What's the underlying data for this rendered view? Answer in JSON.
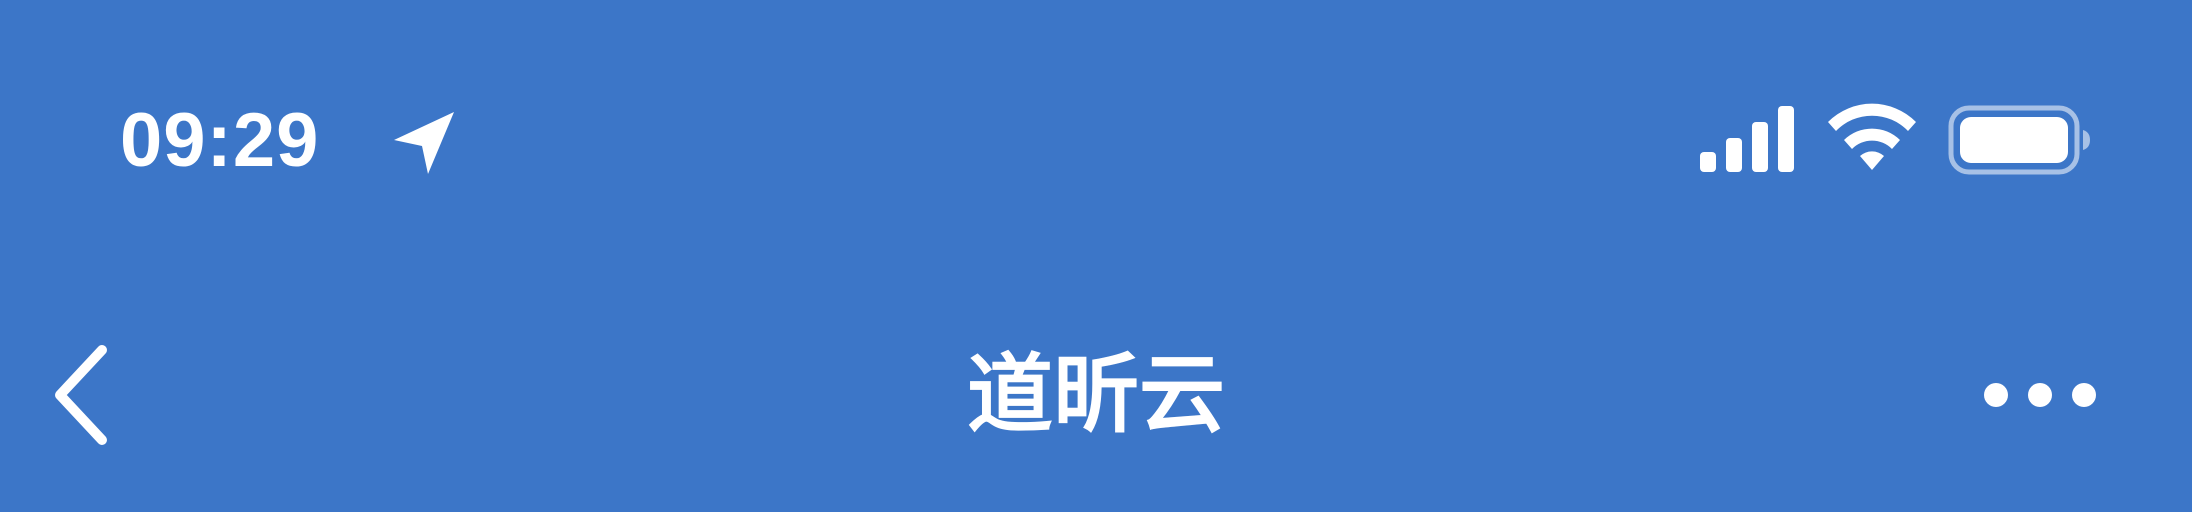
{
  "colors": {
    "background": "#3c76c8",
    "foreground": "#ffffff"
  },
  "status_bar": {
    "time": "09:29",
    "location_icon": "location-arrow-icon",
    "signal_icon": "cellular-signal-icon",
    "wifi_icon": "wifi-icon",
    "battery_icon": "battery-icon"
  },
  "nav_bar": {
    "back_icon": "chevron-left-icon",
    "title": "道昕云",
    "more_icon": "more-horizontal-icon"
  }
}
